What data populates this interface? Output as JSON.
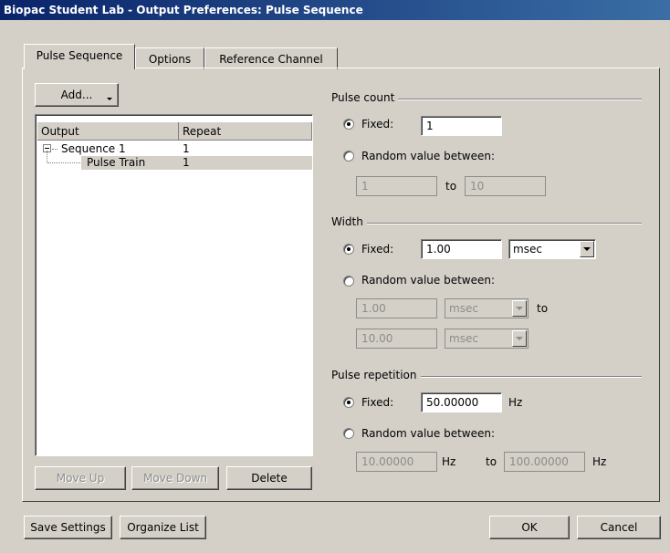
{
  "window": {
    "title": "Biopac Student Lab - Output Preferences: Pulse Sequence"
  },
  "tabs": [
    {
      "label": "Pulse Sequence",
      "active": true
    },
    {
      "label": "Options",
      "active": false
    },
    {
      "label": "Reference Channel",
      "active": false
    }
  ],
  "left": {
    "add_label": "Add...",
    "list": {
      "headers": [
        "Output",
        "Repeat"
      ],
      "rows": [
        {
          "output": "Sequence 1",
          "repeat": "1",
          "selected": false
        },
        {
          "output": "Pulse Train",
          "repeat": "1",
          "selected": true
        }
      ]
    },
    "move_up_label": "Move Up",
    "move_down_label": "Move Down",
    "delete_label": "Delete"
  },
  "pulse_count": {
    "group_label": "Pulse count",
    "fixed_label": "Fixed:",
    "fixed_value": "1",
    "random_label": "Random value between:",
    "random_min": "1",
    "to_label": "to",
    "random_max": "10",
    "mode": "fixed"
  },
  "width": {
    "group_label": "Width",
    "fixed_label": "Fixed:",
    "fixed_value": "1.00",
    "fixed_unit": "msec",
    "random_label": "Random value between:",
    "random_min": "1.00",
    "random_min_unit": "msec",
    "to_label": "to",
    "random_max": "10.00",
    "random_max_unit": "msec",
    "mode": "fixed"
  },
  "pulse_repetition": {
    "group_label": "Pulse repetition",
    "fixed_label": "Fixed:",
    "fixed_value": "50.00000",
    "fixed_unit": "Hz",
    "random_label": "Random value between:",
    "random_min": "10.00000",
    "random_min_unit": "Hz",
    "to_label": "to",
    "random_max": "100.00000",
    "random_max_unit": "Hz",
    "mode": "fixed"
  },
  "footer": {
    "save_label": "Save Settings",
    "organize_label": "Organize List",
    "ok_label": "OK",
    "cancel_label": "Cancel"
  }
}
